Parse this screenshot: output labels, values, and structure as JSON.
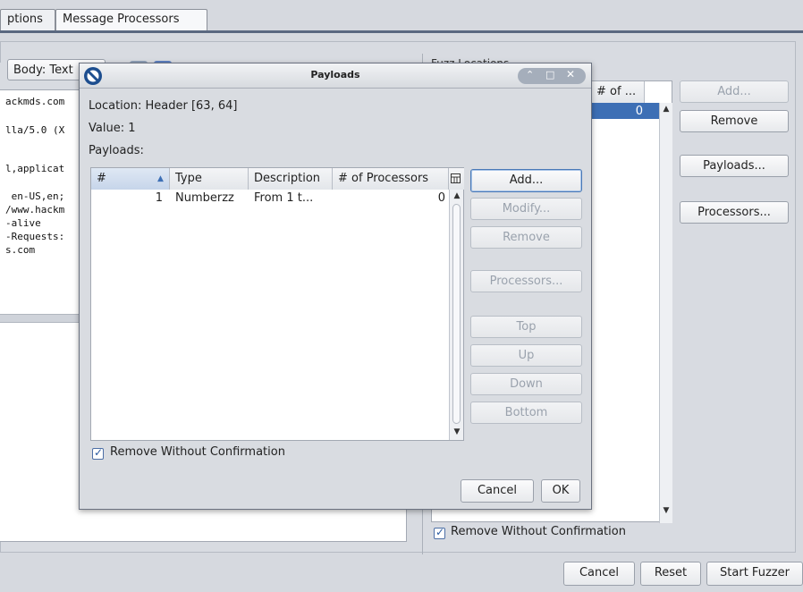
{
  "tabs": [
    {
      "label": "ptions"
    },
    {
      "label": "Message Processors"
    }
  ],
  "left_pane": {
    "body_select": "Body: Text",
    "request_lines": [
      "ackmds.com",
      "lla/5.0 (X",
      "l,applicat",
      " en-US,en;",
      "/www.hackm",
      "-alive",
      "-Requests:",
      "s.com"
    ]
  },
  "fuzz_locations": {
    "header_text": "Fuzz Locations",
    "col_num_processors": "# of ...",
    "row_value": "0",
    "buttons": {
      "add": "Add...",
      "remove": "Remove",
      "payloads": "Payloads...",
      "processors": "Processors..."
    },
    "remove_without_confirmation": "Remove Without Confirmation"
  },
  "bottom_buttons": {
    "cancel": "Cancel",
    "reset": "Reset",
    "start": "Start Fuzzer"
  },
  "dialog": {
    "title": "Payloads",
    "location": "Location: Header [63, 64]",
    "value": "Value: 1",
    "payloads_label": "Payloads:",
    "columns": [
      "#",
      "Type",
      "Description",
      "# of Processors"
    ],
    "rows": [
      {
        "num": "1",
        "type": "Numberzz",
        "description": "From 1 t...",
        "processors": "0"
      }
    ],
    "buttons": {
      "add": "Add...",
      "modify": "Modify...",
      "remove": "Remove",
      "processors": "Processors...",
      "top": "Top",
      "up": "Up",
      "down": "Down",
      "bottom": "Bottom"
    },
    "remove_without_confirmation": "Remove Without Confirmation",
    "cancel": "Cancel",
    "ok": "OK"
  }
}
